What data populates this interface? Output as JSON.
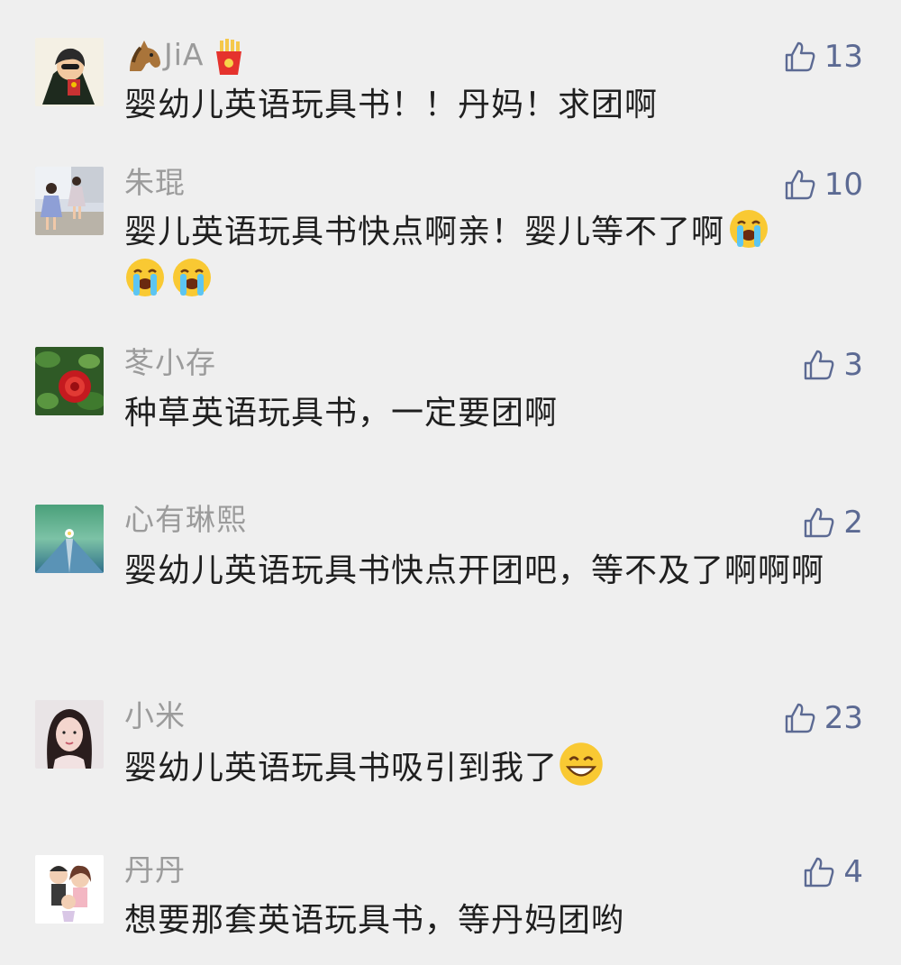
{
  "comments": [
    {
      "name": "JiA",
      "text": "婴幼儿英语玩具书！！丹妈！求团啊",
      "likes": "13",
      "avatar": "cartoon-hero-avatar",
      "name_emojis": [
        "horse-emoji",
        "fries-emoji"
      ]
    },
    {
      "name": "朱琨",
      "text": "婴儿英语玩具书快点啊亲！婴儿等不了啊",
      "likes": "10",
      "avatar": "children-photo-avatar",
      "text_emojis": [
        "crying-emoji",
        "crying-emoji",
        "crying-emoji"
      ]
    },
    {
      "name": "苳小存",
      "text": "种草英语玩具书，一定要团啊",
      "likes": "3",
      "avatar": "red-flower-avatar"
    },
    {
      "name": "心有琳熙",
      "text": "婴幼儿英语玩具书快点开团吧，等不及了啊啊啊",
      "likes": "2",
      "avatar": "book-flower-avatar"
    },
    {
      "name": "小米",
      "text": "婴幼儿英语玩具书吸引到我了",
      "likes": "23",
      "avatar": "woman-portrait-avatar",
      "text_emojis": [
        "grinning-emoji"
      ]
    },
    {
      "name": "丹丹",
      "text": "想要那套英语玩具书，等丹妈团哟",
      "likes": "4",
      "avatar": "cartoon-couple-avatar"
    }
  ],
  "colors": {
    "background": "#efefef",
    "name": "#9b9b9b",
    "text": "#1f1f1f",
    "like": "#5c6a93"
  }
}
